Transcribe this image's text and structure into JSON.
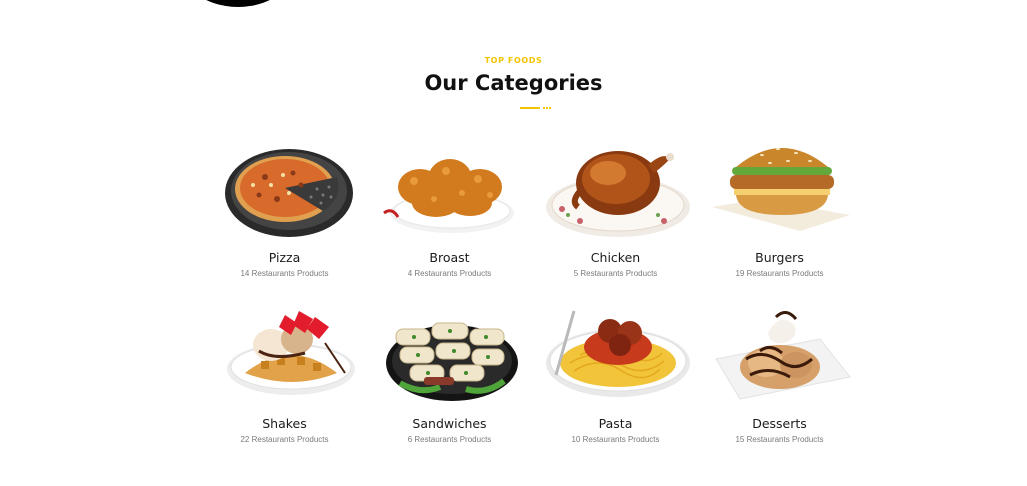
{
  "section": {
    "eyebrow": "TOP FOODS",
    "title": "Our Categories"
  },
  "colors": {
    "accent": "#f3c400",
    "title": "#111111",
    "muted": "#7a7a7a"
  },
  "categories": [
    {
      "name": "Pizza",
      "count": "14 Restaurants Products",
      "icon": "pizza-icon"
    },
    {
      "name": "Broast",
      "count": "4 Restaurants Products",
      "icon": "broast-icon"
    },
    {
      "name": "Chicken",
      "count": "5 Restaurants Products",
      "icon": "chicken-icon"
    },
    {
      "name": "Burgers",
      "count": "19 Restaurants Products",
      "icon": "burger-icon"
    },
    {
      "name": "Shakes",
      "count": "22 Restaurants Products",
      "icon": "shakes-icon"
    },
    {
      "name": "Sandwiches",
      "count": "6 Restaurants Products",
      "icon": "sandwich-icon"
    },
    {
      "name": "Pasta",
      "count": "10 Restaurants Products",
      "icon": "pasta-icon"
    },
    {
      "name": "Desserts",
      "count": "15 Restaurants Products",
      "icon": "dessert-icon"
    }
  ]
}
